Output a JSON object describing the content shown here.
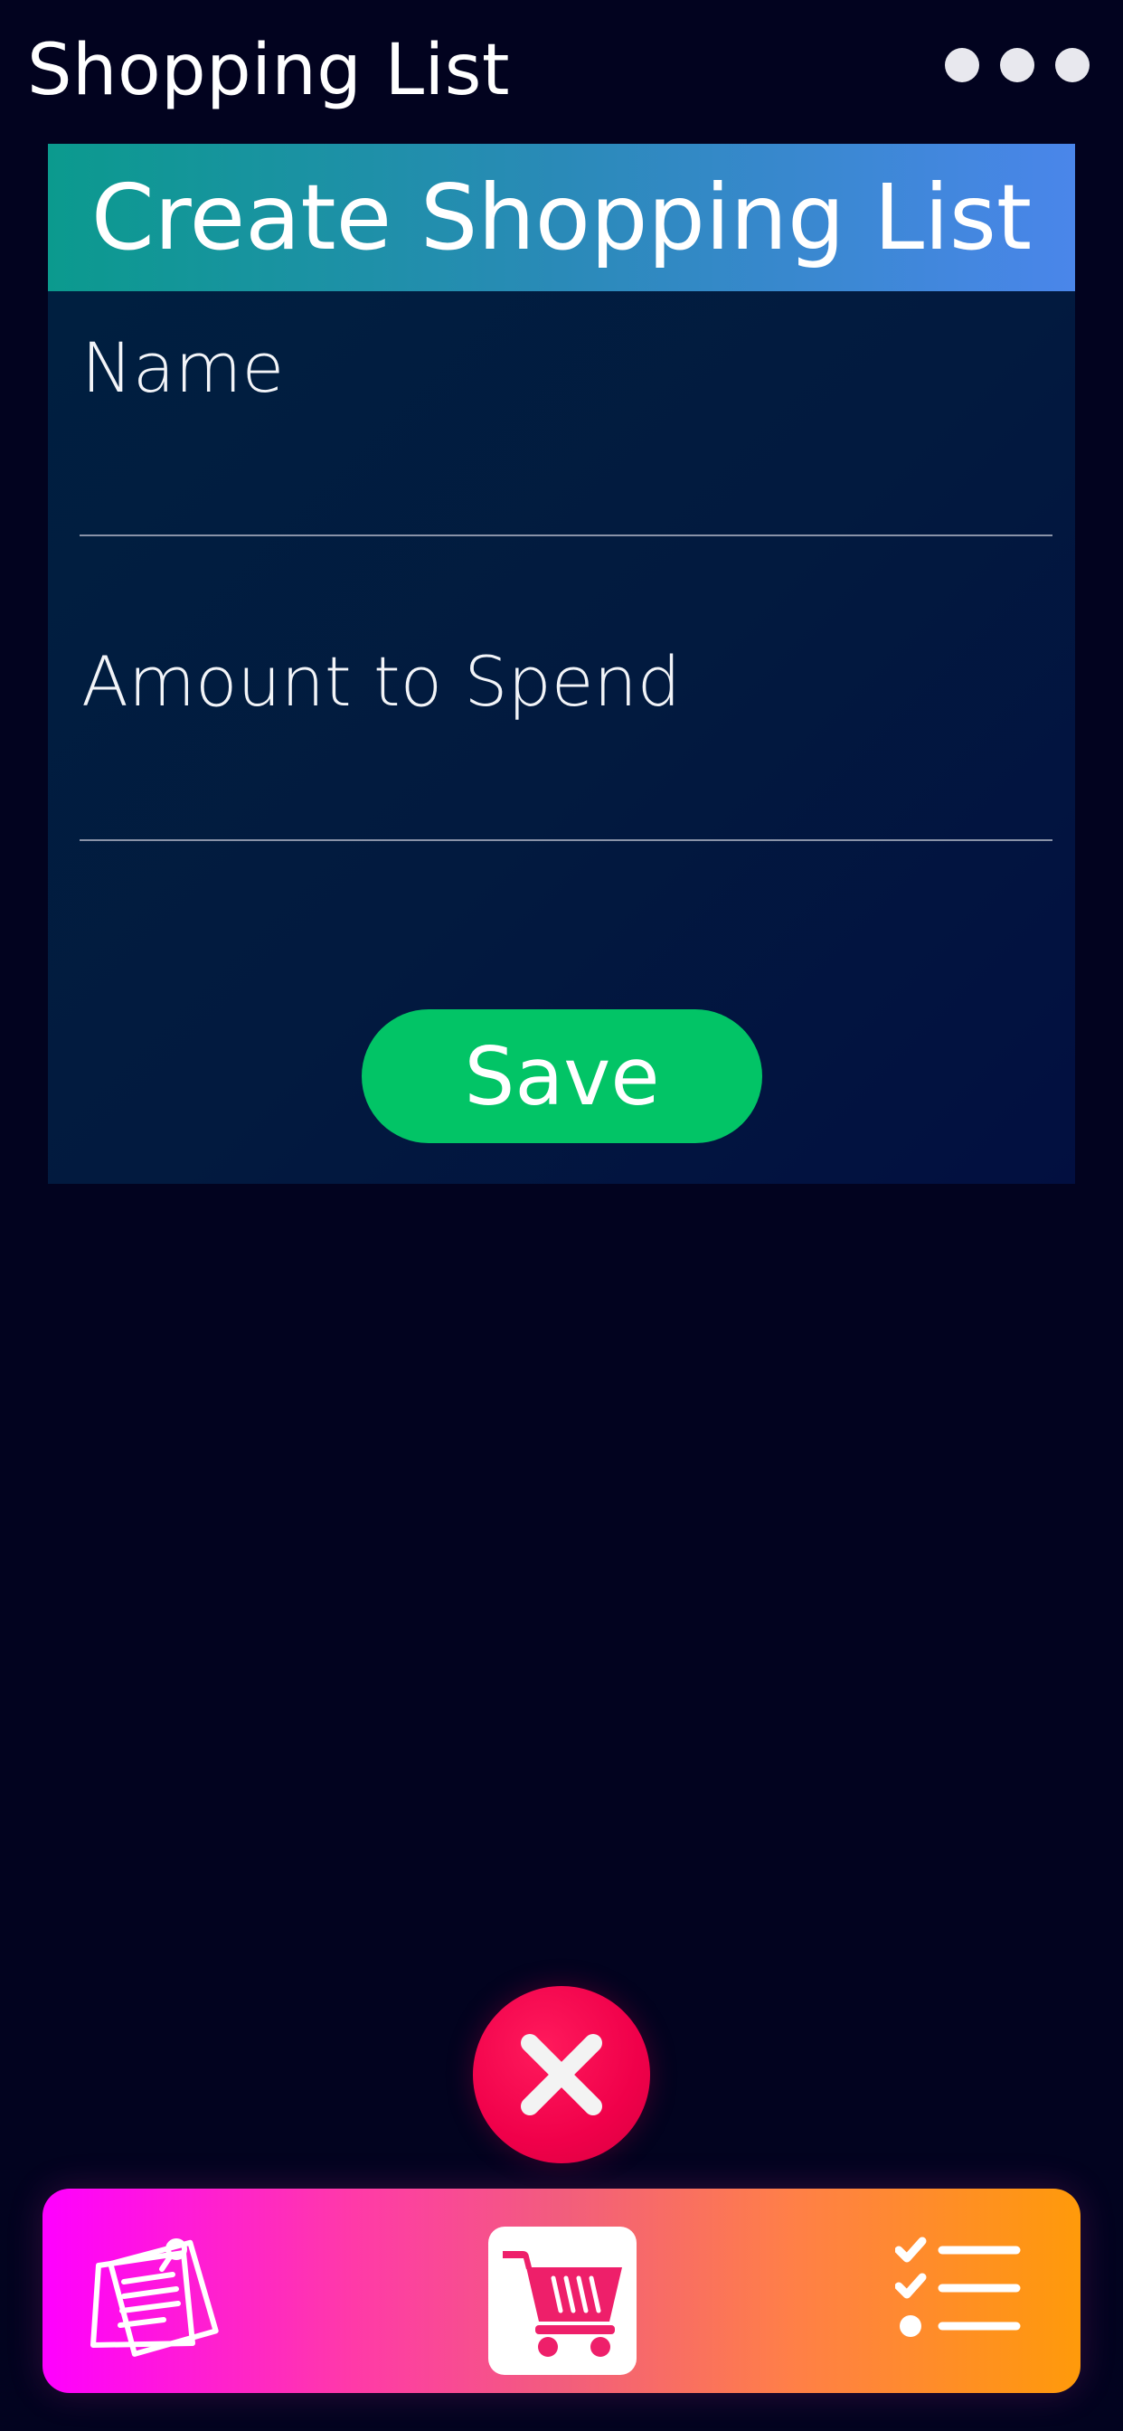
{
  "header": {
    "title": "Shopping List",
    "menu_icon": "more-horizontal-icon"
  },
  "card": {
    "title": "Create Shopping List",
    "fields": [
      {
        "label": "Name",
        "value": "",
        "placeholder": ""
      },
      {
        "label": "Amount to Spend",
        "value": "",
        "placeholder": ""
      }
    ],
    "save_label": "Save"
  },
  "close_icon": "close-icon",
  "bottom_nav": {
    "items": [
      {
        "name": "notes",
        "icon": "notes-icon"
      },
      {
        "name": "cart",
        "icon": "cart-icon",
        "active": true
      },
      {
        "name": "checklist",
        "icon": "checklist-icon"
      }
    ]
  },
  "colors": {
    "background": "#02031f",
    "card_header_start": "#0b9a8e",
    "card_header_end": "#4a86ea",
    "save_button": "#02c466",
    "close_button": "#f0004a",
    "nav_gradient_start": "#ff00ff",
    "nav_gradient_end": "#ff9a0a",
    "cart_icon": "#ee1f6a"
  }
}
